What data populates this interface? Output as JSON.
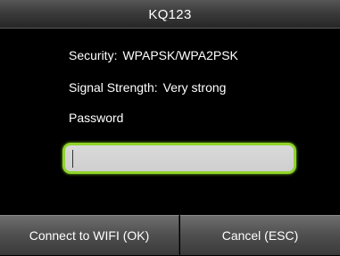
{
  "window": {
    "title": "KQ123"
  },
  "network": {
    "security_label": "Security:",
    "security_value": "WPAPSK/WPA2PSK",
    "signal_label": "Signal Strength:",
    "signal_value": "Very strong",
    "password_label": "Password"
  },
  "password_field": {
    "value": "",
    "placeholder": ""
  },
  "buttons": {
    "connect_label": "Connect to WIFI (OK)",
    "cancel_label": "Cancel (ESC)"
  },
  "colors": {
    "background": "#000000",
    "field_focus_border": "#8fd42a",
    "text": "#ffffff"
  }
}
